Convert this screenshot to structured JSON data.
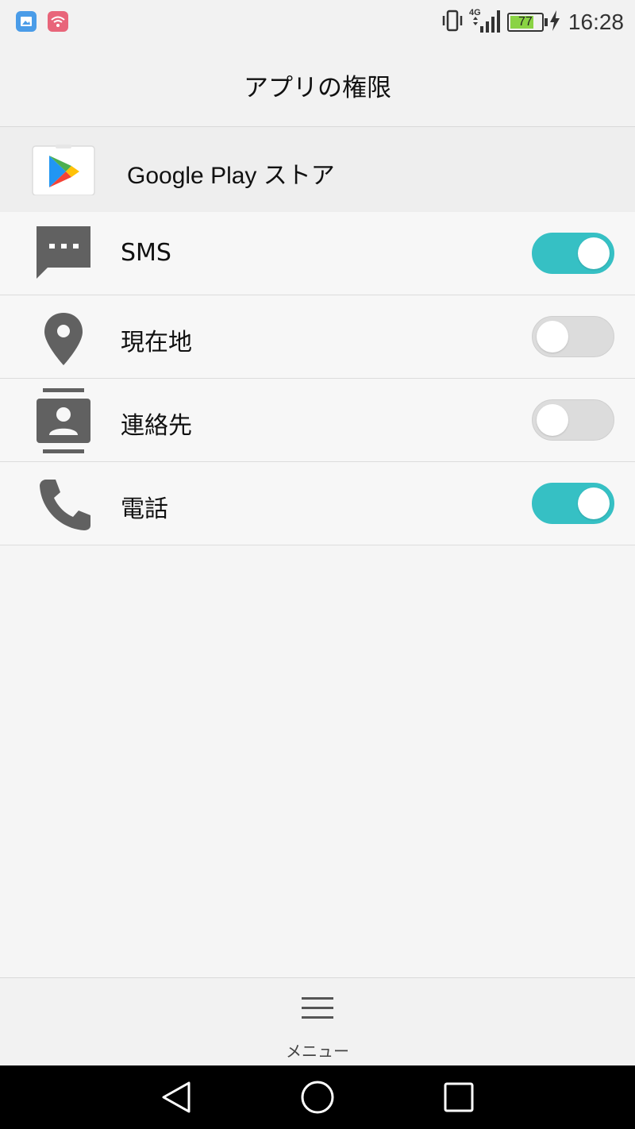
{
  "status_bar": {
    "time": "16:28",
    "battery_level": "77",
    "network": "4G",
    "left_icons": [
      "gallery-notification-icon",
      "wifi-notification-icon"
    ],
    "right_icons": [
      "vibrate-icon",
      "signal-icon",
      "battery-icon",
      "charging-icon"
    ]
  },
  "header": {
    "title": "アプリの権限"
  },
  "app": {
    "name": "Google Play ストア",
    "icon": "google-play-icon"
  },
  "permissions": [
    {
      "label": "SMS",
      "icon": "sms-icon",
      "enabled": true
    },
    {
      "label": "現在地",
      "icon": "location-icon",
      "enabled": false
    },
    {
      "label": "連絡先",
      "icon": "contacts-icon",
      "enabled": false
    },
    {
      "label": "電話",
      "icon": "phone-icon",
      "enabled": true
    }
  ],
  "bottom_menu": {
    "label": "メニュー",
    "icon": "menu-icon"
  },
  "nav_bar": {
    "buttons": [
      "back-icon",
      "home-icon",
      "recents-icon"
    ]
  },
  "colors": {
    "toggle_on": "#36c0c4",
    "toggle_off": "#dcdcdc",
    "icon_gray": "#616161",
    "battery_fill": "#8ad344"
  }
}
